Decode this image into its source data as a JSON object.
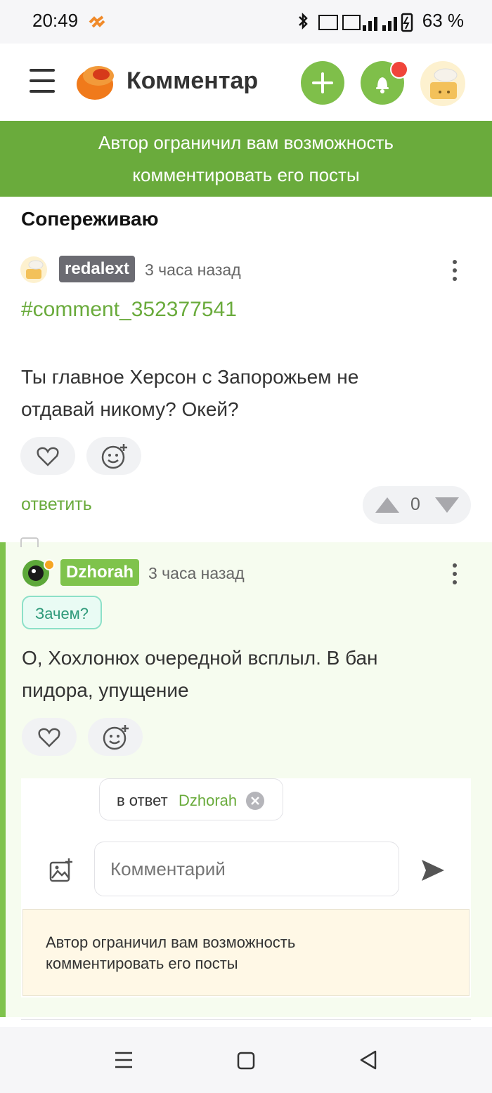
{
  "status_bar": {
    "time": "20:49",
    "battery": "63 %"
  },
  "header": {
    "app_title": "Комментар"
  },
  "toast": {
    "line1": "Автор ограничил вам возможность",
    "line2": "комментировать его посты"
  },
  "section_title": "Сопереживаю",
  "comment1": {
    "username": "redalext",
    "time": "3 часа назад",
    "link": "#comment_352377541",
    "text_line1": "Ты главное Херсон с Запорожьем не",
    "text_line2": "отдавай никому? Окей?",
    "reply_label": "ответить",
    "rating": "0"
  },
  "comment2": {
    "username": "Dzhorah",
    "time": "3 часа назад",
    "tag": "Зачем?",
    "text_line1": "О, Хохлонюх очередной всплыл. В бан",
    "text_line2": "пидора, упущение"
  },
  "reply_form": {
    "reply_to_prefix": "в ответ",
    "reply_to_user": "Dzhorah",
    "placeholder": "Комментарий",
    "blocked_line1": "Автор ограничил вам возможность",
    "blocked_line2": "комментировать его посты"
  },
  "colors": {
    "brand_green": "#6aab3c",
    "accent_orange": "#f07a1b",
    "notify_red": "#f0453a"
  }
}
